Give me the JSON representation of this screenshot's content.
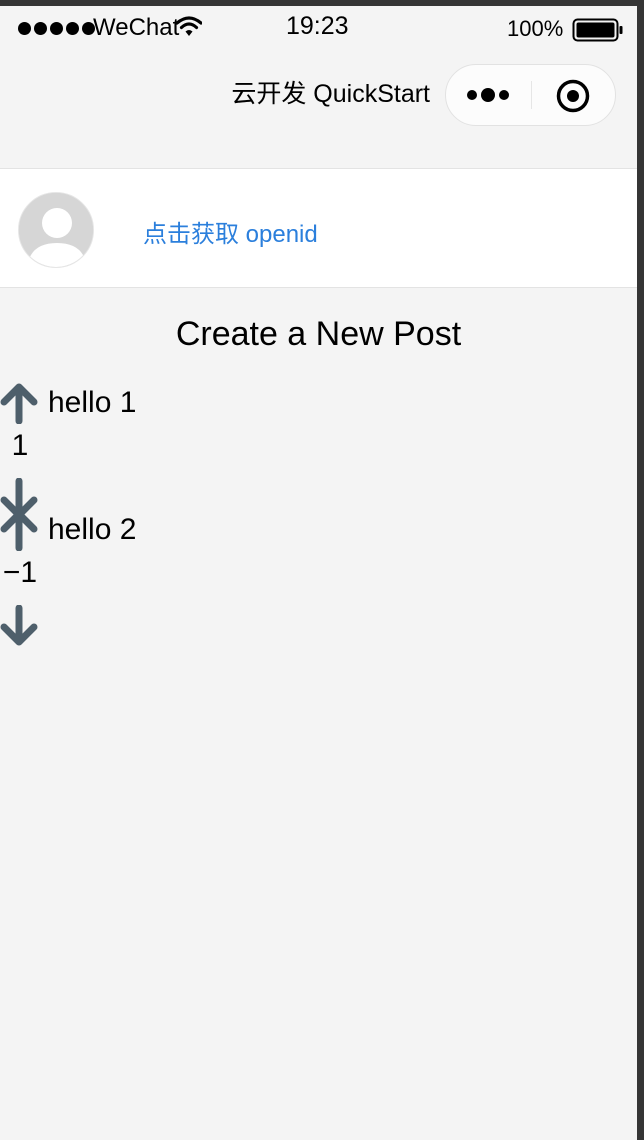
{
  "status_bar": {
    "carrier": "WeChat",
    "time": "19:23",
    "battery": "100%"
  },
  "nav": {
    "title": "云开发 QuickStart"
  },
  "user": {
    "openid_link": "点击获取 openid"
  },
  "main": {
    "heading": "Create a New Post",
    "posts": [
      {
        "text": "hello 1",
        "score": "1"
      },
      {
        "text": "hello 2",
        "score": "−1"
      }
    ]
  },
  "colors": {
    "link": "#2b7fdc",
    "vote_arrow": "#4e5f6b",
    "background": "#f4f4f4"
  },
  "icons": [
    "signal-icon",
    "wifi-icon",
    "battery-icon",
    "more-icon",
    "close-icon",
    "avatar",
    "upvote-icon",
    "downvote-icon"
  ]
}
